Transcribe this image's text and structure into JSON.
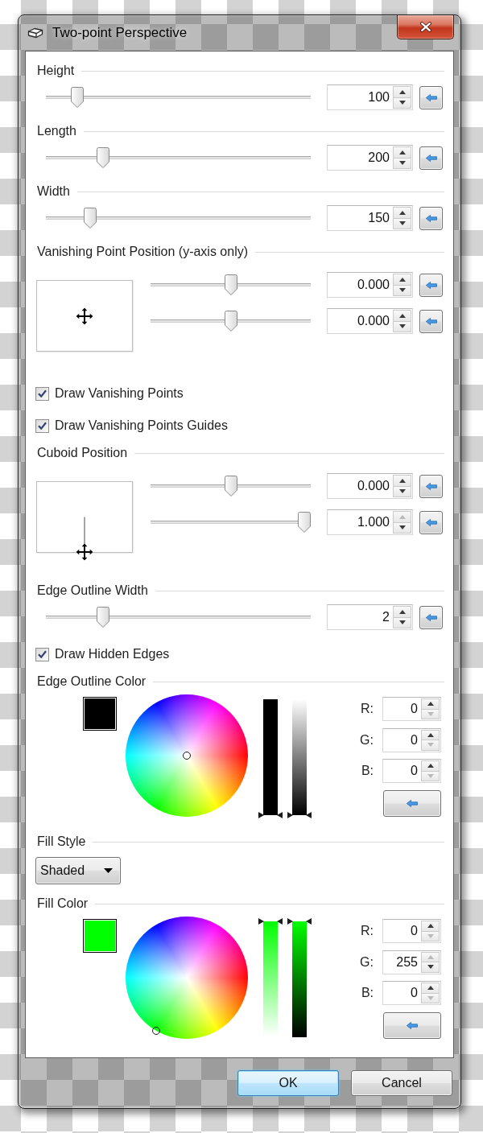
{
  "window": {
    "title": "Two-point Perspective"
  },
  "sections": [
    {
      "kind": "slider",
      "label": "Height",
      "sliders": [
        {
          "level": 0.1,
          "value": "100",
          "up_disabled": false,
          "down_disabled": false
        }
      ]
    },
    {
      "kind": "slider",
      "label": "Length",
      "sliders": [
        {
          "level": 0.2,
          "value": "200",
          "up_disabled": false,
          "down_disabled": false
        }
      ]
    },
    {
      "kind": "slider",
      "label": "Width",
      "sliders": [
        {
          "level": 0.15,
          "value": "150",
          "up_disabled": false,
          "down_disabled": false
        }
      ]
    },
    {
      "kind": "pad",
      "label": "Vanishing Point Position (y-axis only)",
      "sliders": [
        {
          "level": 0.5,
          "value": "0.000",
          "up_disabled": false,
          "down_disabled": false
        },
        {
          "level": 0.5,
          "value": "0.000",
          "up_disabled": false,
          "down_disabled": false
        }
      ]
    },
    {
      "kind": "checkbox",
      "label": "Draw Vanishing Points",
      "checked": true
    },
    {
      "kind": "checkbox",
      "label": "Draw Vanishing Points Guides",
      "checked": true
    },
    {
      "kind": "pad",
      "label": "Cuboid Position",
      "sliders": [
        {
          "level": 0.5,
          "value": "0.000",
          "up_disabled": false,
          "down_disabled": false
        },
        {
          "level": 1,
          "value": "1.000",
          "up_disabled": true,
          "down_disabled": false
        }
      ]
    },
    {
      "kind": "slider",
      "label": "Edge Outline Width",
      "sliders": [
        {
          "level": 0.2,
          "value": "2",
          "up_disabled": false,
          "down_disabled": false
        }
      ]
    },
    {
      "kind": "checkbox",
      "label": "Draw Hidden Edges",
      "checked": true
    },
    {
      "kind": "color",
      "label": "Edge Outline Color",
      "color": "#000000",
      "channels": [
        {
          "label": "R:",
          "value": "0",
          "up_disabled": false,
          "down_disabled": true
        },
        {
          "label": "G:",
          "value": "0",
          "up_disabled": false,
          "down_disabled": true
        },
        {
          "label": "B:",
          "value": "0",
          "up_disabled": false,
          "down_disabled": true
        }
      ]
    },
    {
      "kind": "dropdown",
      "label": "Fill Style",
      "value": "Shaded"
    },
    {
      "kind": "color",
      "label": "Fill Color",
      "color": "#00ff00",
      "channels": [
        {
          "label": "R:",
          "value": "0",
          "up_disabled": false,
          "down_disabled": true
        },
        {
          "label": "G:",
          "value": "255",
          "up_disabled": true,
          "down_disabled": false
        },
        {
          "label": "B:",
          "value": "0",
          "up_disabled": false,
          "down_disabled": true
        }
      ]
    }
  ],
  "buttons": [
    {
      "label": "OK",
      "focused": true
    },
    {
      "label": "Cancel",
      "focused": false
    }
  ]
}
